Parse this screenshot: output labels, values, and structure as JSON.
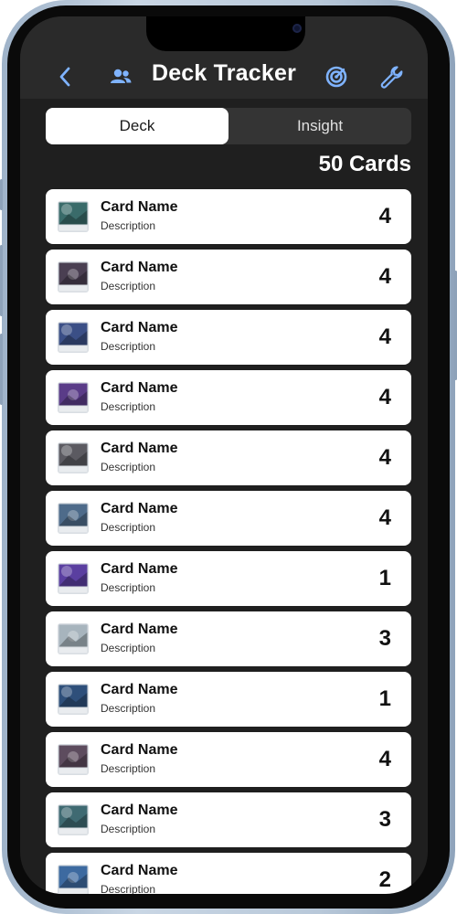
{
  "header": {
    "title": "Deck Tracker",
    "icons": [
      "chevron-left-icon",
      "people-icon",
      "target-icon",
      "wrench-icon"
    ],
    "accent": "#7fb3ff"
  },
  "tabs": [
    {
      "label": "Deck",
      "active": true
    },
    {
      "label": "Insight",
      "active": false
    }
  ],
  "summary": {
    "count_label": "50 Cards"
  },
  "cards": [
    {
      "name": "Card Name",
      "description": "Description",
      "quantity": "4",
      "art": "#3a6b6a"
    },
    {
      "name": "Card Name",
      "description": "Description",
      "quantity": "4",
      "art": "#4a3f52"
    },
    {
      "name": "Card Name",
      "description": "Description",
      "quantity": "4",
      "art": "#3b4f86"
    },
    {
      "name": "Card Name",
      "description": "Description",
      "quantity": "4",
      "art": "#5a3c88"
    },
    {
      "name": "Card Name",
      "description": "Description",
      "quantity": "4",
      "art": "#5b5a61"
    },
    {
      "name": "Card Name",
      "description": "Description",
      "quantity": "4",
      "art": "#4e6b8a"
    },
    {
      "name": "Card Name",
      "description": "Description",
      "quantity": "1",
      "art": "#5a3fa0"
    },
    {
      "name": "Card Name",
      "description": "Description",
      "quantity": "3",
      "art": "#a7b4bd"
    },
    {
      "name": "Card Name",
      "description": "Description",
      "quantity": "1",
      "art": "#2e4f7a"
    },
    {
      "name": "Card Name",
      "description": "Description",
      "quantity": "4",
      "art": "#5d4c5e"
    },
    {
      "name": "Card Name",
      "description": "Description",
      "quantity": "3",
      "art": "#3f6a72"
    },
    {
      "name": "Card Name",
      "description": "Description",
      "quantity": "2",
      "art": "#3d6aa0"
    }
  ]
}
